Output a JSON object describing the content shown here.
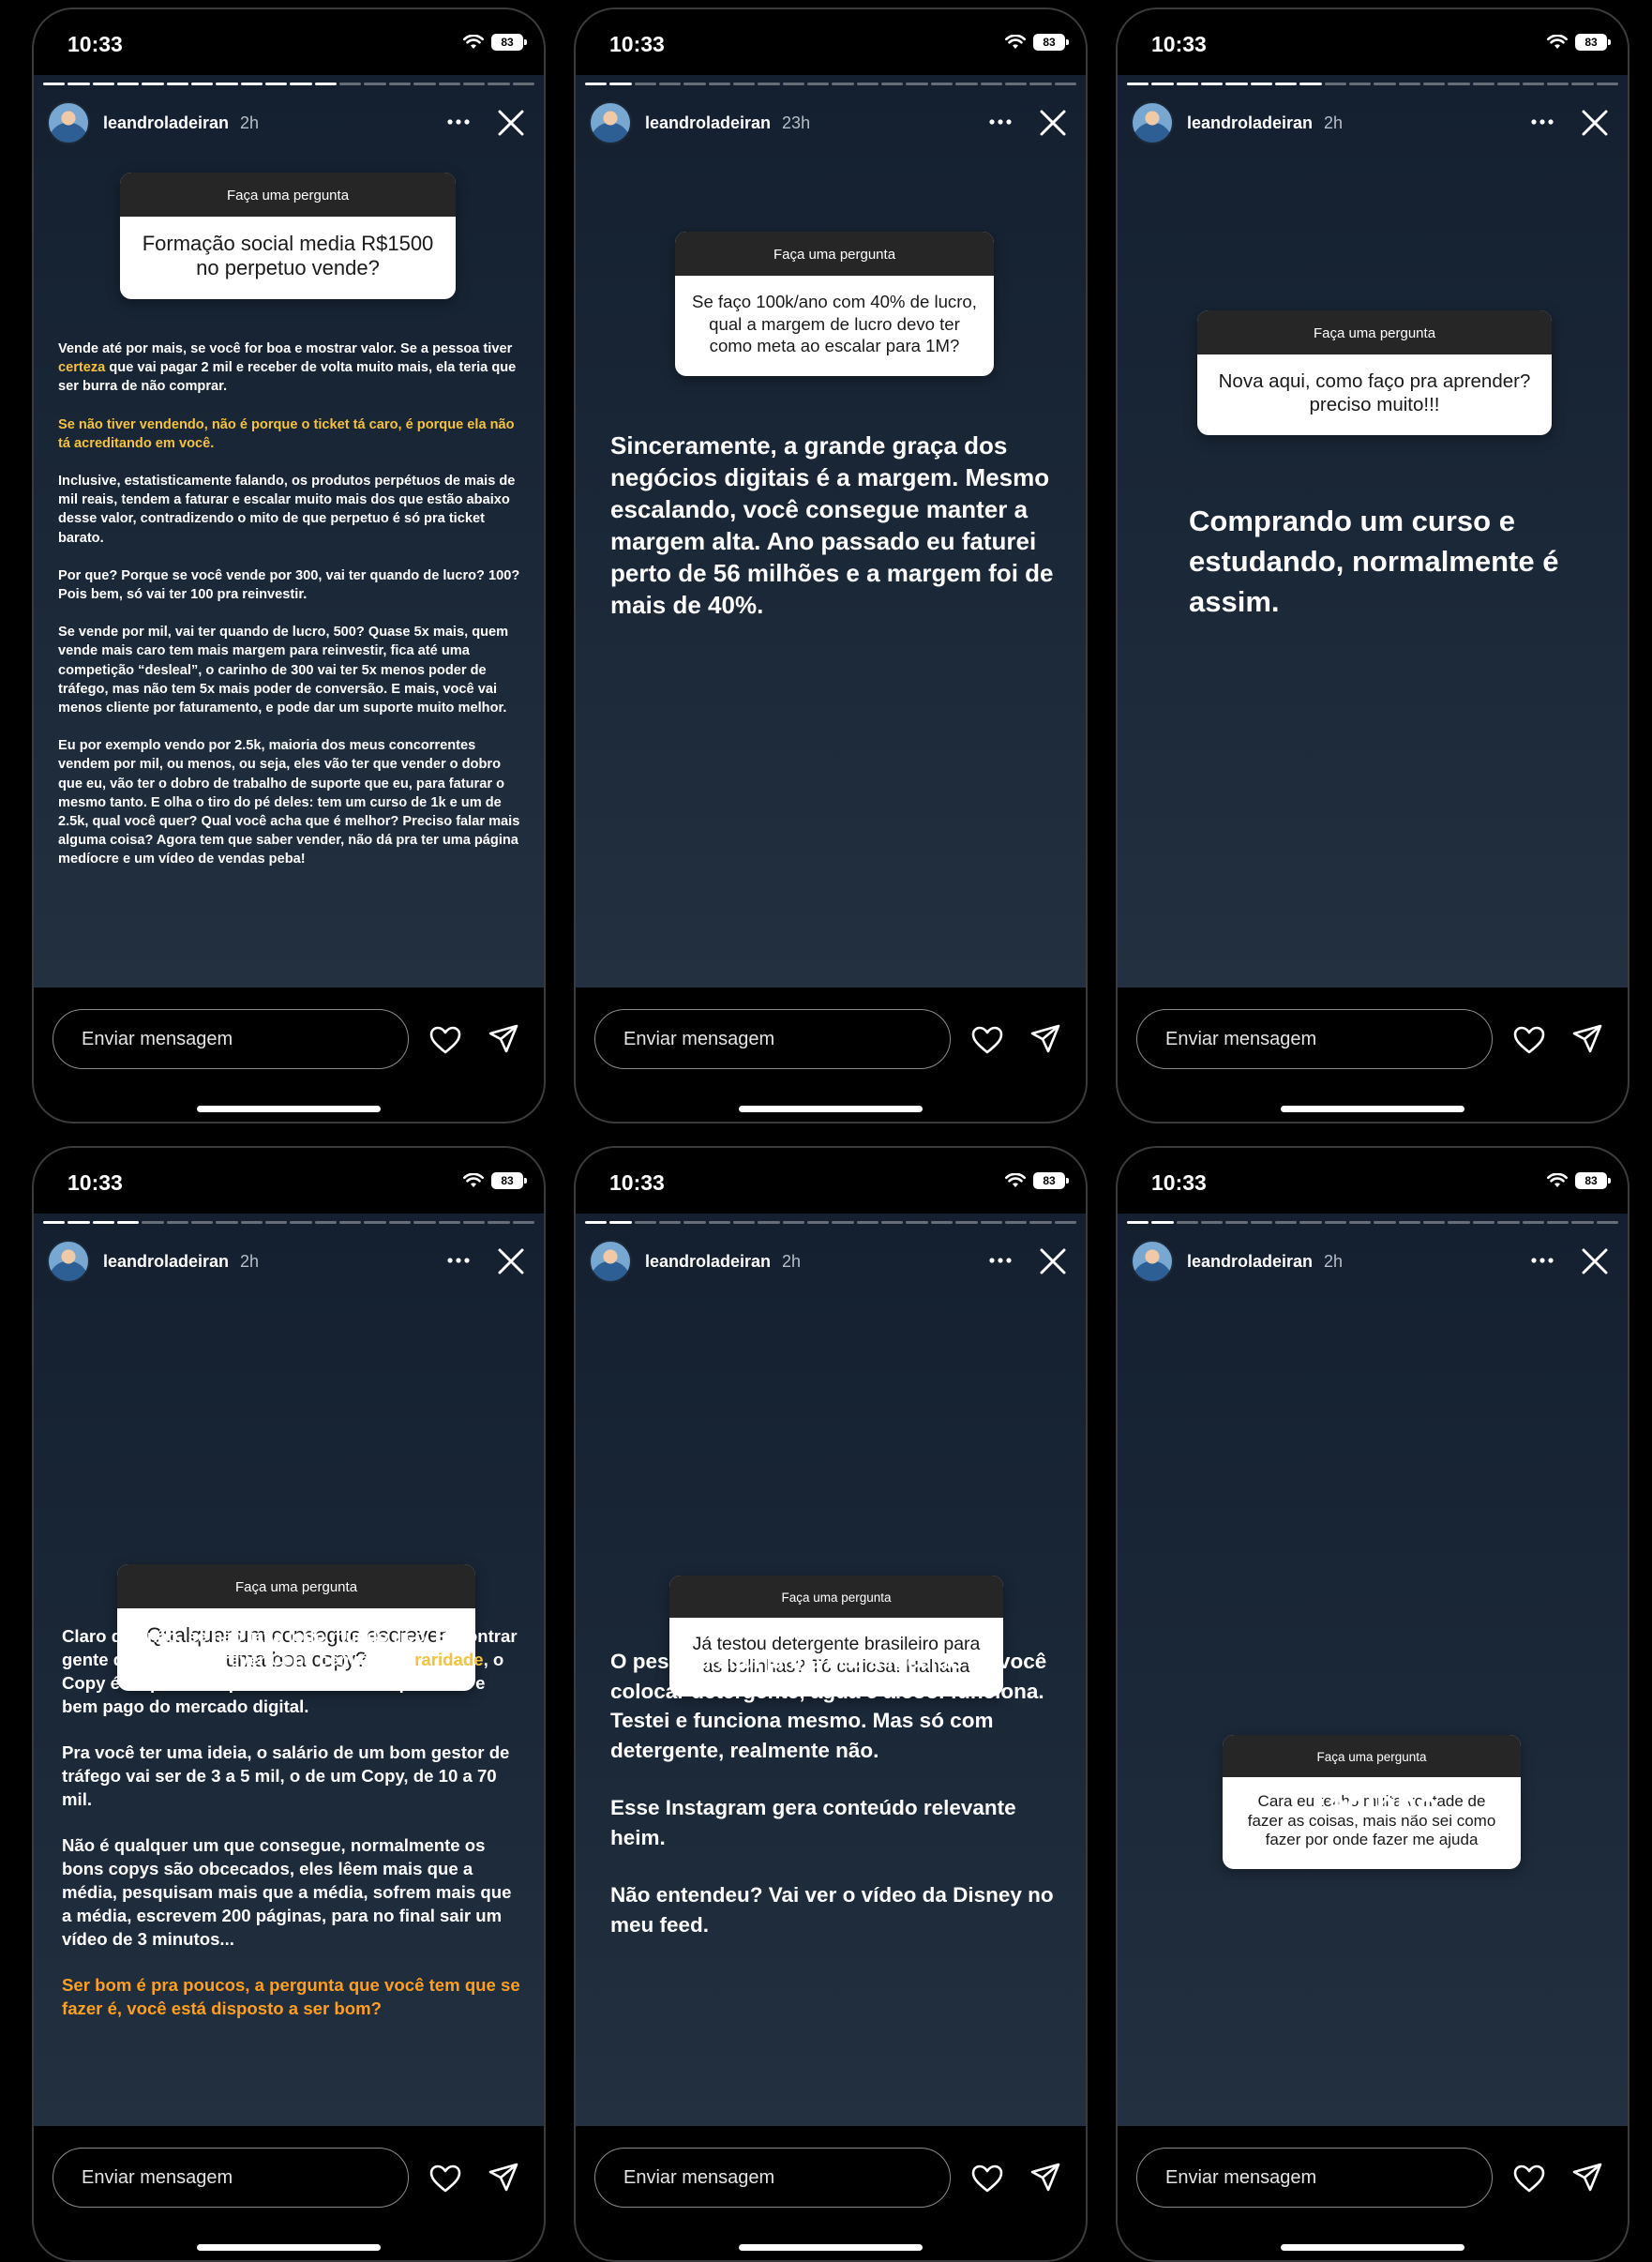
{
  "ui": {
    "time": "10:33",
    "battery": "83",
    "username": "leandroladeiran",
    "question_header": "Faça uma pergunta",
    "message_placeholder": "Enviar mensagem"
  },
  "stories": [
    {
      "ago": "2h",
      "question": "Formação social media R$1500 no perpetuo vende?",
      "answer": [
        [
          {
            "t": "Vende até por mais, se você for boa e mostrar valor. Se a pessoa tiver "
          },
          {
            "t": "certeza",
            "hl": "yellow"
          },
          {
            "t": " que vai pagar 2 mil e receber de volta muito mais, ela teria que ser burra de não comprar."
          }
        ],
        [
          {
            "t": "Se não tiver vendendo, não é porque o ticket tá caro, é porque ela não tá acreditando em você.",
            "hl": "yellow"
          }
        ],
        [
          {
            "t": "Inclusive, estatisticamente falando, os produtos perpétuos de mais de mil reais, tendem a faturar e escalar muito mais dos que estão abaixo desse valor, contradizendo o mito de que perpetuo é só pra ticket barato."
          }
        ],
        [
          {
            "t": "Por que? Porque se você vende por 300, vai ter quando de lucro? 100? Pois bem, só vai ter 100 pra reinvestir."
          }
        ],
        [
          {
            "t": "Se vende por mil, vai ter quando de lucro, 500? Quase 5x mais, quem vende mais caro tem mais margem para reinvestir, fica até uma competição “desleal”, o carinho de 300 vai ter 5x menos poder de tráfego, mas não tem 5x mais poder de conversão. E mais, você vai menos cliente por faturamento, e pode dar um suporte muito melhor."
          }
        ],
        [
          {
            "t": "Eu por exemplo vendo por 2.5k, maioria dos meus concorrentes vendem por mil, ou menos, ou seja, eles vão ter que vender o dobro que eu, vão ter o dobro de trabalho de suporte que eu, para faturar o mesmo tanto. E olha o tiro do pé deles: tem um curso de 1k e um de 2.5k, qual você quer? Qual você acha que é melhor? Preciso falar mais alguma coisa? Agora tem que saber vender, não dá pra ter uma página medíocre e um vídeo de vendas peba!"
          }
        ]
      ]
    },
    {
      "ago": "23h",
      "question": "Se faço 100k/ano com 40% de lucro, qual a margem de lucro devo ter como meta ao escalar para 1M?",
      "answer": [
        [
          {
            "t": "Sinceramente, a grande graça dos negócios digitais é a margem. Mesmo escalando, você consegue manter a margem alta. Ano passado eu faturei perto de 56 milhões e a margem foi de mais de 40%."
          }
        ]
      ]
    },
    {
      "ago": "2h",
      "question": "Nova aqui, como faço pra aprender? preciso muito!!!",
      "answer": [
        [
          {
            "t": "Comprando um curso e estudando, normalmente é assim."
          }
        ]
      ]
    },
    {
      "ago": "2h",
      "question": "Qualquer um consegue escrever uma boa copy?",
      "answer": [
        [
          {
            "t": "Claro que não, se não tava todo mundo rico. Encontrar gente que sabe escrever Copy bem é uma "
          },
          {
            "t": "raridade",
            "hl": "yellow"
          },
          {
            "t": ", o Copy é disparado o profissional mais requisitado e bem pago do mercado digital."
          }
        ],
        [
          {
            "t": "Pra você ter uma ideia, o salário de um bom gestor de tráfego vai ser de 3 a 5 mil, o de um Copy, de 10 a 70 mil."
          }
        ],
        [
          {
            "t": "Não é qualquer um que consegue, normalmente os bons copys são obcecados, eles lêem mais que a média, pesquisam mais que a média, sofrem mais que a média, escrevem 200 páginas, para no final sair um vídeo de 3 minutos..."
          }
        ],
        [
          {
            "t": "Ser bom é pra poucos, a pergunta que você tem que se fazer é, você está disposto a ser bom?",
            "hl": "orange"
          }
        ]
      ]
    },
    {
      "ago": "2h",
      "question": "Já testou detergente brasileiro para as bolinhas? Tô curiosa! Hahaha",
      "answer": [
        [
          {
            "t": "O pessoal aqui já me deu a receita. Se você colocar detergente, água e álcool funciona. Testei e funciona mesmo. Mas só com detergente,  realmente não."
          }
        ],
        [
          {
            "t": "Esse Instagram gera conteúdo relevante heim."
          }
        ],
        [
          {
            "t": "Não entendeu? Vai ver o vídeo da Disney no meu feed."
          }
        ]
      ]
    },
    {
      "ago": "2h",
      "question": "Cara eu tenho muita vontade de fazer as coisas, mais não sei como fazer por onde fazer me ajuda",
      "answer": [
        [
          {
            "t": "Tadinho"
          }
        ]
      ]
    }
  ]
}
